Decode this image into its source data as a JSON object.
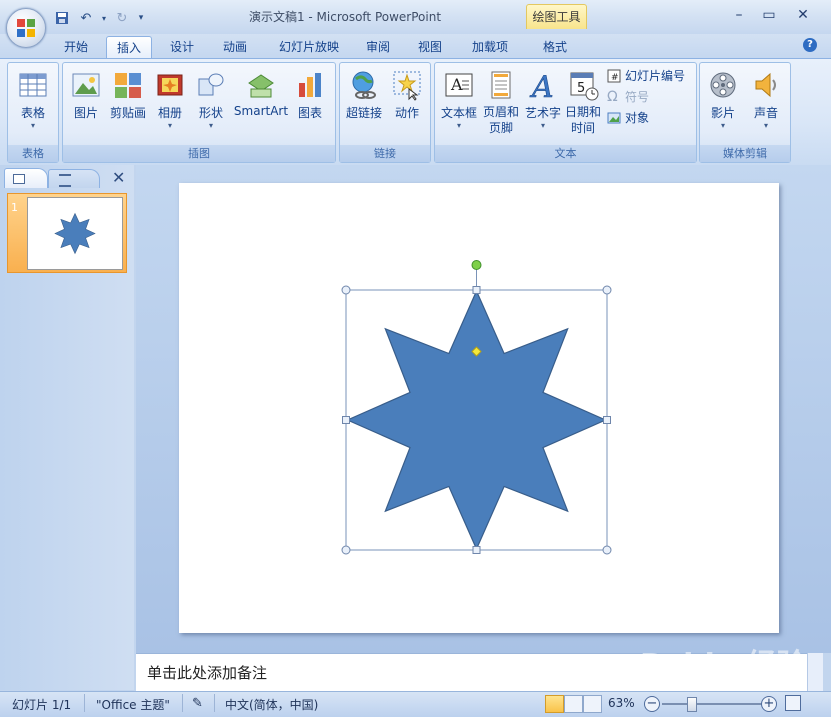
{
  "app": {
    "title": "演示文稿1 - Microsoft PowerPoint",
    "context_tab_group": "绘图工具"
  },
  "tabs": [
    {
      "label": "开始"
    },
    {
      "label": "插入",
      "active": true
    },
    {
      "label": "设计"
    },
    {
      "label": "动画"
    },
    {
      "label": "幻灯片放映"
    },
    {
      "label": "审阅"
    },
    {
      "label": "视图"
    },
    {
      "label": "加载项"
    },
    {
      "label": "格式"
    }
  ],
  "ribbon": {
    "groups": {
      "table": {
        "label": "表格",
        "table": "表格"
      },
      "illustrations": {
        "label": "插图",
        "picture": "图片",
        "clipart": "剪贴画",
        "album": "相册",
        "shapes": "形状",
        "smartart": "SmartArt",
        "chart": "图表"
      },
      "links": {
        "label": "链接",
        "hyperlink": "超链接",
        "action": "动作"
      },
      "text": {
        "label": "文本",
        "textbox": "文本框",
        "header_footer_1": "页眉和",
        "header_footer_2": "页脚",
        "wordart": "艺术字",
        "datetime_1": "日期和",
        "datetime_2": "时间",
        "slide_number": "幻灯片编号",
        "symbol": "符号",
        "object": "对象"
      },
      "media": {
        "label": "媒体剪辑",
        "movie": "影片",
        "sound": "声音"
      }
    }
  },
  "slides_panel": {
    "thumb_number": "1"
  },
  "notes": {
    "placeholder": "单击此处添加备注"
  },
  "status": {
    "slide_info": "幻灯片 1/1",
    "theme": "\"Office 主题\"",
    "language": "中文(简体，中国)",
    "zoom": "63%",
    "zoom_level": 0.63
  },
  "watermark": "Baidu 经验",
  "colors": {
    "star_fill": "#4a7ebb",
    "star_stroke": "#385d8a",
    "accent_orange": "#f9b04f"
  }
}
